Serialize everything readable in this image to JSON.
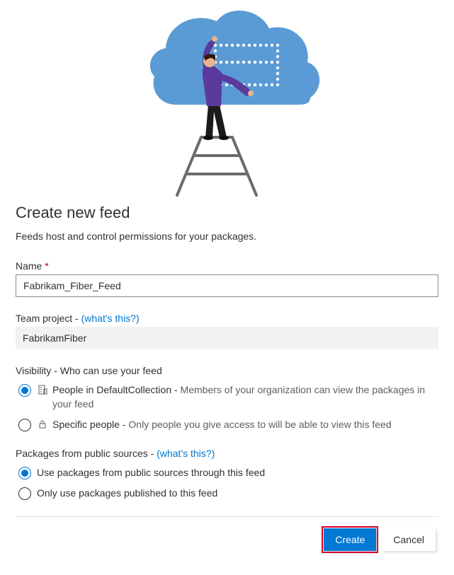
{
  "title": "Create new feed",
  "subtitle": "Feeds host and control permissions for your packages.",
  "name_field": {
    "label": "Name",
    "required_marker": "*",
    "value": "Fabrikam_Fiber_Feed"
  },
  "team_project": {
    "label": "Team project - ",
    "whats_this": "(what's this?)",
    "value": "FabrikamFiber"
  },
  "visibility": {
    "label": "Visibility - Who can use your feed",
    "options": [
      {
        "selected": true,
        "title": "People in DefaultCollection - ",
        "desc": "Members of your organization can view the packages in your feed"
      },
      {
        "selected": false,
        "title": "Specific people - ",
        "desc": "Only people you give access to will be able to view this feed"
      }
    ]
  },
  "public_sources": {
    "label": "Packages from public sources - ",
    "whats_this": "(what's this?)",
    "options": [
      {
        "selected": true,
        "label": "Use packages from public sources through this feed"
      },
      {
        "selected": false,
        "label": "Only use packages published to this feed"
      }
    ]
  },
  "buttons": {
    "create": "Create",
    "cancel": "Cancel"
  }
}
